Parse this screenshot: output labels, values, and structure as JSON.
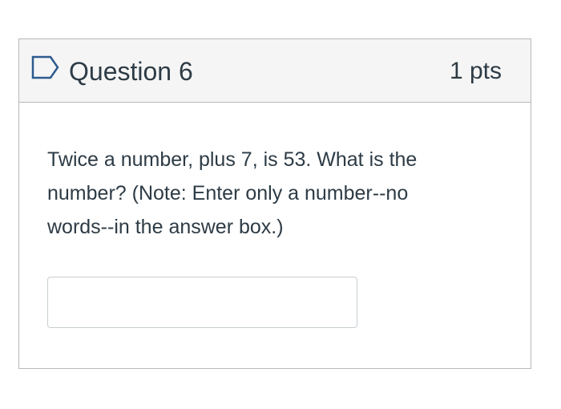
{
  "question": {
    "title": "Question 6",
    "points": "1 pts",
    "flag_icon": "flag-outline-icon",
    "text": "Twice a number, plus 7, is 53. What is the number? (Note: Enter only a number--no words--in the answer box.)",
    "answer": {
      "value": "",
      "placeholder": ""
    }
  },
  "colors": {
    "header_bg": "#f5f5f5",
    "border": "#b8b8b8",
    "text": "#2d3b45",
    "flag": "#2d5b8e"
  }
}
